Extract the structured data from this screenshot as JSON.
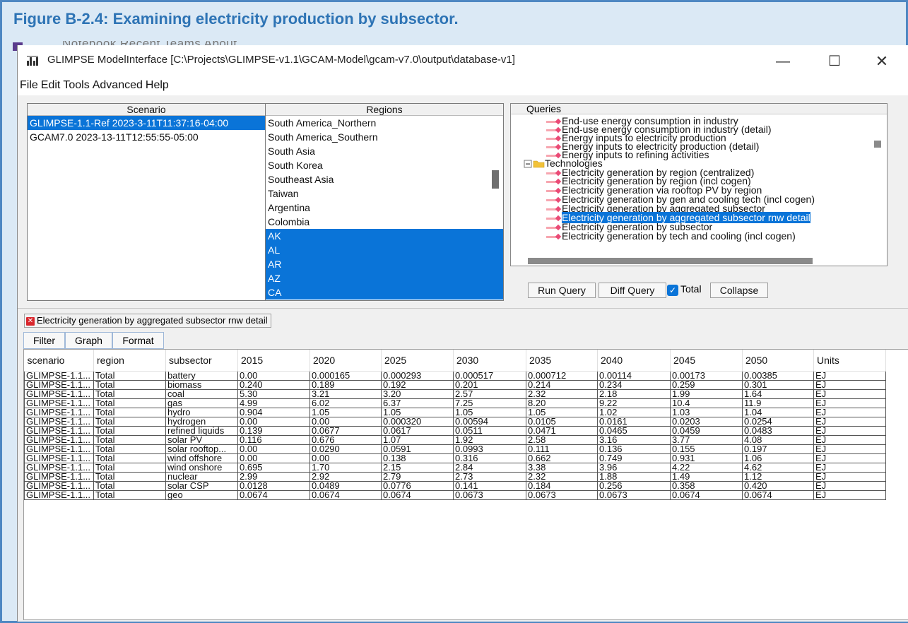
{
  "figure_caption": "Figure B-2.4: Examining electricity production by subsector.",
  "background_nav": {
    "text": "Notebook    Recent    Teams    About"
  },
  "window": {
    "title": "GLIMPSE ModelInterface [C:\\Projects\\GLIMPSE-v1.1\\GCAM-Model\\gcam-v7.0\\output\\database-v1]",
    "controls": {
      "minimize": "—",
      "maximize": "☐",
      "close": "✕"
    }
  },
  "menu": [
    "File",
    "Edit",
    "Tools",
    "Advanced",
    "Help"
  ],
  "scenario_panel": {
    "header": "Scenario",
    "items": [
      {
        "label": "GLIMPSE-1.1-Ref 2023-3-11T11:37:16-04:00",
        "selected": true
      },
      {
        "label": "GCAM7.0 2023-13-11T12:55:55-05:00",
        "selected": false
      }
    ]
  },
  "regions_panel": {
    "header": "Regions",
    "items": [
      {
        "label": "South America_Northern",
        "selected": false
      },
      {
        "label": "South America_Southern",
        "selected": false
      },
      {
        "label": "South Asia",
        "selected": false
      },
      {
        "label": "South Korea",
        "selected": false
      },
      {
        "label": "Southeast Asia",
        "selected": false
      },
      {
        "label": "Taiwan",
        "selected": false
      },
      {
        "label": "Argentina",
        "selected": false
      },
      {
        "label": "Colombia",
        "selected": false
      },
      {
        "label": "AK",
        "selected": true
      },
      {
        "label": "AL",
        "selected": true
      },
      {
        "label": "AR",
        "selected": true
      },
      {
        "label": "AZ",
        "selected": true
      },
      {
        "label": "CA",
        "selected": true
      }
    ]
  },
  "queries_panel": {
    "header": "Queries",
    "tree": [
      {
        "label": "End-use energy consumption in industry",
        "type": "leaf",
        "selected": false
      },
      {
        "label": "End-use energy consumption in industry (detail)",
        "type": "leaf",
        "selected": false
      },
      {
        "label": "Energy inputs to electricity production",
        "type": "leaf",
        "selected": false
      },
      {
        "label": "Energy inputs to electricity production (detail)",
        "type": "leaf",
        "selected": false
      },
      {
        "label": "Energy inputs to refining activities",
        "type": "leaf",
        "selected": false
      },
      {
        "label": "Technologies",
        "type": "folder",
        "selected": false
      },
      {
        "label": "Electricity generation by region (centralized)",
        "type": "leaf",
        "selected": false
      },
      {
        "label": "Electricity generation by region (incl cogen)",
        "type": "leaf",
        "selected": false
      },
      {
        "label": "Electricity generation via rooftop PV by region",
        "type": "leaf",
        "selected": false
      },
      {
        "label": "Electricity generation by gen and cooling tech (incl cogen)",
        "type": "leaf",
        "selected": false
      },
      {
        "label": "Electricity generation by aggregated subsector",
        "type": "leaf",
        "selected": false
      },
      {
        "label": "Electricity generation by aggregated subsector rnw detail",
        "type": "leaf",
        "selected": true
      },
      {
        "label": "Electricity generation by subsector",
        "type": "leaf",
        "selected": false
      },
      {
        "label": "Electricity generation by tech and cooling (incl cogen)",
        "type": "leaf",
        "selected": false
      }
    ]
  },
  "query_buttons": {
    "run": "Run Query",
    "diff": "Diff Query",
    "total_label": "Total",
    "total_checked": true,
    "collapse": "Collapse"
  },
  "result_tab": {
    "label": "Electricity generation by aggregated subsector rnw detail"
  },
  "result_subtabs": [
    "Filter",
    "Graph",
    "Format"
  ],
  "table": {
    "columns": [
      "scenario",
      "region",
      "subsector",
      "2015",
      "2020",
      "2025",
      "2030",
      "2035",
      "2040",
      "2045",
      "2050",
      "Units"
    ],
    "rows": [
      [
        "GLIMPSE-1.1...",
        "Total",
        "battery",
        "0.00",
        "0.000165",
        "0.000293",
        "0.000517",
        "0.000712",
        "0.00114",
        "0.00173",
        "0.00385",
        "EJ"
      ],
      [
        "GLIMPSE-1.1...",
        "Total",
        "biomass",
        "0.240",
        "0.189",
        "0.192",
        "0.201",
        "0.214",
        "0.234",
        "0.259",
        "0.301",
        "EJ"
      ],
      [
        "GLIMPSE-1.1...",
        "Total",
        "coal",
        "5.30",
        "3.21",
        "3.20",
        "2.57",
        "2.32",
        "2.18",
        "1.99",
        "1.64",
        "EJ"
      ],
      [
        "GLIMPSE-1.1...",
        "Total",
        "gas",
        "4.99",
        "6.02",
        "6.37",
        "7.25",
        "8.20",
        "9.22",
        "10.4",
        "11.9",
        "EJ"
      ],
      [
        "GLIMPSE-1.1...",
        "Total",
        "hydro",
        "0.904",
        "1.05",
        "1.05",
        "1.05",
        "1.05",
        "1.02",
        "1.03",
        "1.04",
        "EJ"
      ],
      [
        "GLIMPSE-1.1...",
        "Total",
        "hydrogen",
        "0.00",
        "0.00",
        "0.000320",
        "0.00594",
        "0.0105",
        "0.0161",
        "0.0203",
        "0.0254",
        "EJ"
      ],
      [
        "GLIMPSE-1.1...",
        "Total",
        "refined liquids",
        "0.139",
        "0.0677",
        "0.0617",
        "0.0511",
        "0.0471",
        "0.0465",
        "0.0459",
        "0.0483",
        "EJ"
      ],
      [
        "GLIMPSE-1.1...",
        "Total",
        "solar PV",
        "0.116",
        "0.676",
        "1.07",
        "1.92",
        "2.58",
        "3.16",
        "3.77",
        "4.08",
        "EJ"
      ],
      [
        "GLIMPSE-1.1...",
        "Total",
        "solar rooftop...",
        "0.00",
        "0.0290",
        "0.0591",
        "0.0993",
        "0.111",
        "0.136",
        "0.155",
        "0.197",
        "EJ"
      ],
      [
        "GLIMPSE-1.1...",
        "Total",
        "wind offshore",
        "0.00",
        "0.00",
        "0.138",
        "0.316",
        "0.662",
        "0.749",
        "0.931",
        "1.06",
        "EJ"
      ],
      [
        "GLIMPSE-1.1...",
        "Total",
        "wind onshore",
        "0.695",
        "1.70",
        "2.15",
        "2.84",
        "3.38",
        "3.96",
        "4.22",
        "4.62",
        "EJ"
      ],
      [
        "GLIMPSE-1.1...",
        "Total",
        "nuclear",
        "2.99",
        "2.92",
        "2.79",
        "2.73",
        "2.32",
        "1.88",
        "1.49",
        "1.12",
        "EJ"
      ],
      [
        "GLIMPSE-1.1...",
        "Total",
        "solar CSP",
        "0.0128",
        "0.0489",
        "0.0776",
        "0.141",
        "0.184",
        "0.256",
        "0.358",
        "0.420",
        "EJ"
      ],
      [
        "GLIMPSE-1.1...",
        "Total",
        "geo",
        "0.0674",
        "0.0674",
        "0.0674",
        "0.0673",
        "0.0673",
        "0.0673",
        "0.0674",
        "0.0674",
        "EJ"
      ]
    ]
  },
  "colors": {
    "selection": "#0a74d8",
    "caption": "#2e74b5",
    "frame": "#4e87c2",
    "close_badge": "#d9262c"
  }
}
